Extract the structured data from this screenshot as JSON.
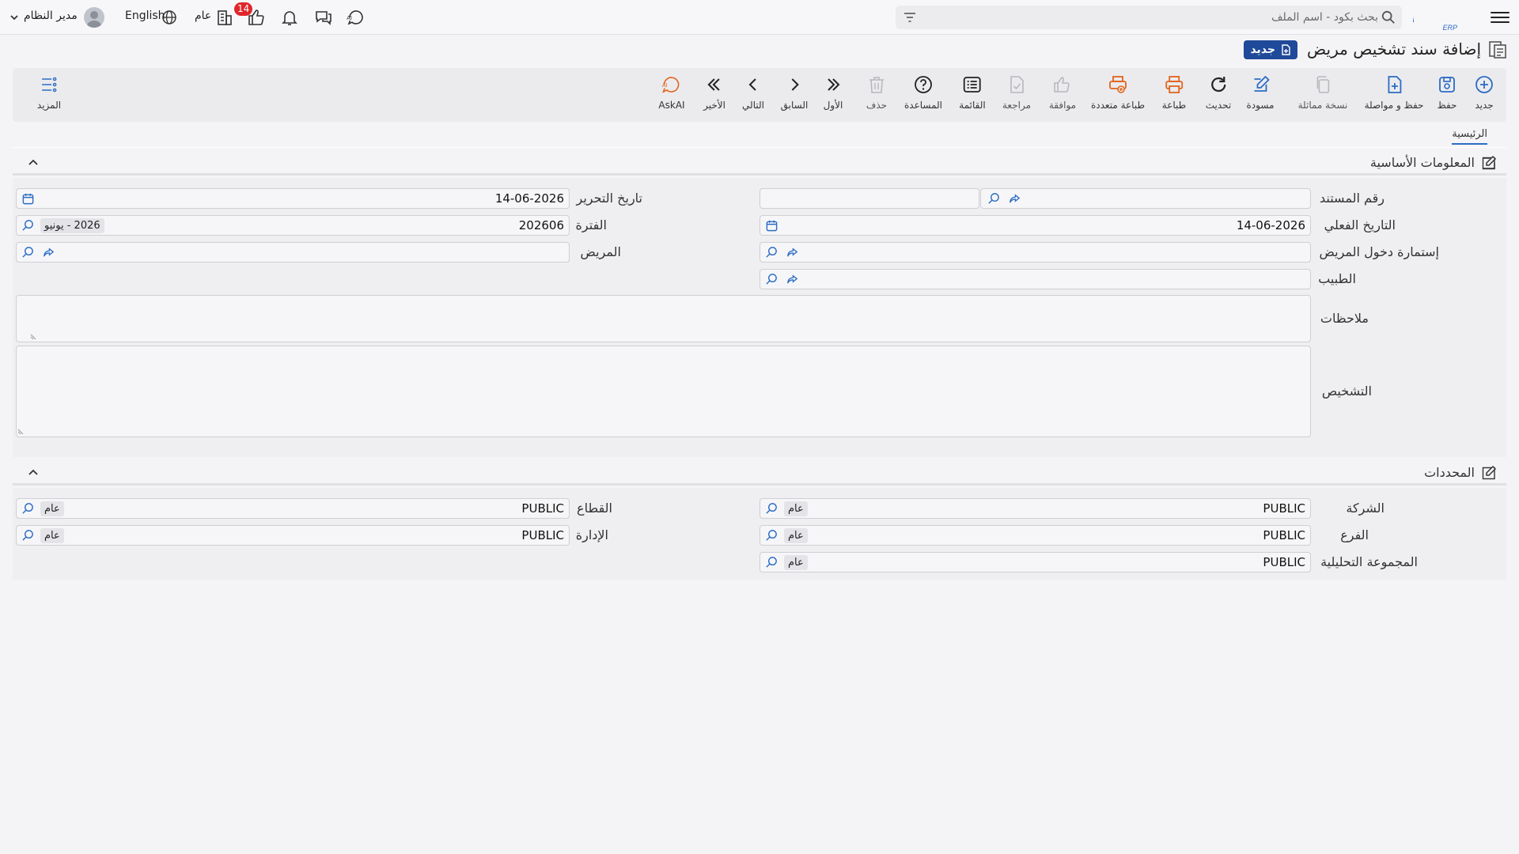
{
  "topbar": {
    "search_placeholder": "بحث بكود - اسم الملف",
    "language": "English",
    "context": "عام",
    "approvals_count": "14",
    "user": "مدير النظام"
  },
  "page": {
    "title": "إضافة سند تشخيص مريض",
    "mode_badge": "جديد"
  },
  "toolbar": {
    "new": "جديد",
    "save": "حفظ",
    "save_continue": "حفظ و مواصلة",
    "duplicate": "نسخة مماثلة",
    "draft": "مسودة",
    "refresh": "تحديث",
    "print": "طباعة",
    "multi_print": "طباعة متعددة",
    "approve": "موافقة",
    "review": "مراجعة",
    "list": "القائمة",
    "help": "المساعدة",
    "delete": "حذف",
    "first": "الأول",
    "previous": "السابق",
    "next": "التالي",
    "last": "الأخير",
    "askai": "AskAI",
    "more": "المزيد"
  },
  "tabs": {
    "main": "الرئيسية"
  },
  "basic_info": {
    "title": "المعلومات الأساسية",
    "doc_number_label": "رقم المستند",
    "doc_number_value": "",
    "issue_date_label": "تاريخ التحرير",
    "issue_date_value": "14-06-2026",
    "actual_date_label": "التاريخ الفعلي",
    "actual_date_value": "14-06-2026",
    "period_label": "الفترة",
    "period_value": "202606",
    "period_tag": "2026 - يونيو",
    "admission_label": "إستمارة دخول المريض",
    "admission_value": "",
    "patient_label": "المريض",
    "patient_value": "",
    "doctor_label": "الطبيب",
    "doctor_value": "",
    "notes_label": "ملاحظات",
    "notes_value": "",
    "diagnosis_label": "التشخيص",
    "diagnosis_value": ""
  },
  "determinants": {
    "title": "المحددات",
    "company_label": "الشركة",
    "company_value": "PUBLIC",
    "company_tag": "عام",
    "sector_label": "القطاع",
    "sector_value": "PUBLIC",
    "sector_tag": "عام",
    "branch_label": "الفرع",
    "branch_value": "PUBLIC",
    "branch_tag": "عام",
    "department_label": "الإدارة",
    "department_value": "PUBLIC",
    "department_tag": "عام",
    "analysis_label": "المجموعة التحليلية",
    "analysis_value": "PUBLIC",
    "analysis_tag": "عام"
  },
  "colors": {
    "brand": "#1f4a99",
    "primary_icon": "#2b6cc4",
    "print_icon": "#e2641b",
    "badge": "#e0262b"
  }
}
